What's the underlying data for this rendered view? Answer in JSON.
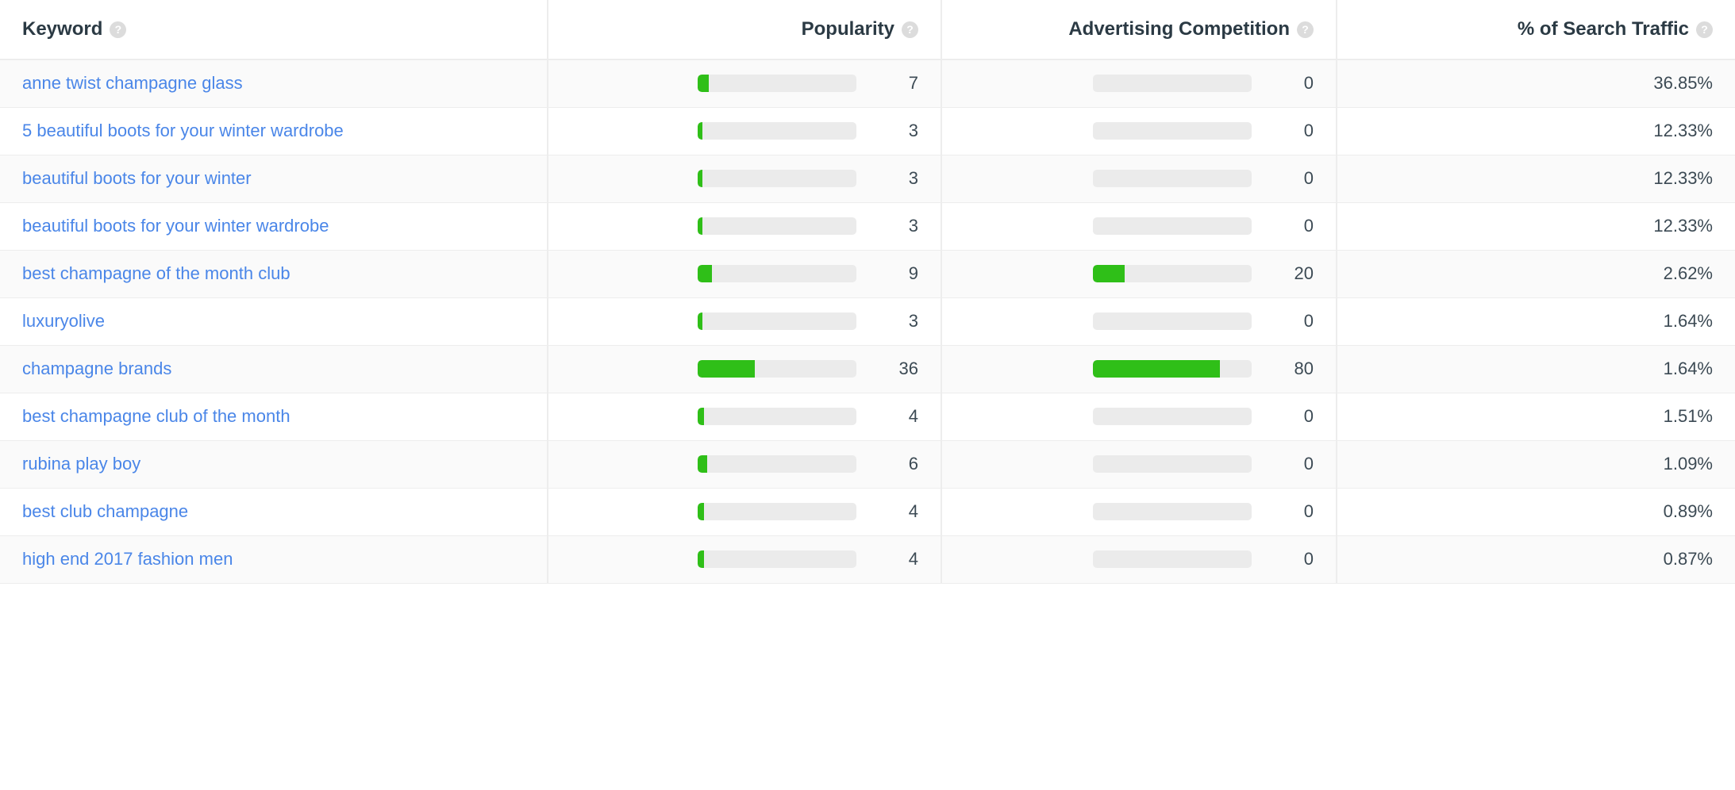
{
  "table": {
    "columns": [
      {
        "key": "keyword",
        "label": "Keyword",
        "help_icon": "help-icon",
        "help_glyph": "?",
        "align": "left"
      },
      {
        "key": "popularity",
        "label": "Popularity",
        "help_icon": "help-icon",
        "help_glyph": "?",
        "align": "right"
      },
      {
        "key": "competition",
        "label": "Advertising Competition",
        "help_icon": "help-icon",
        "help_glyph": "?",
        "align": "right"
      },
      {
        "key": "traffic",
        "label": "% of Search Traffic",
        "help_icon": "help-icon",
        "help_glyph": "?",
        "align": "right"
      }
    ],
    "bar_scale_max": 100,
    "colors": {
      "bar_fill": "#2fbf18",
      "bar_track": "#ebebeb",
      "link": "#4a86e8",
      "text": "#3c4a54",
      "header_text": "#2b3a44",
      "row_odd": "#fafafa",
      "row_even": "#ffffff",
      "border": "#ededed"
    },
    "rows": [
      {
        "keyword": "anne twist champagne glass",
        "popularity": "7",
        "popularity_pct": 7,
        "competition": "0",
        "competition_pct": 0,
        "traffic": "36.85%"
      },
      {
        "keyword": "5 beautiful boots for your winter wardrobe",
        "popularity": "3",
        "popularity_pct": 3,
        "competition": "0",
        "competition_pct": 0,
        "traffic": "12.33%"
      },
      {
        "keyword": "beautiful boots for your winter",
        "popularity": "3",
        "popularity_pct": 3,
        "competition": "0",
        "competition_pct": 0,
        "traffic": "12.33%"
      },
      {
        "keyword": "beautiful boots for your winter wardrobe",
        "popularity": "3",
        "popularity_pct": 3,
        "competition": "0",
        "competition_pct": 0,
        "traffic": "12.33%"
      },
      {
        "keyword": "best champagne of the month club",
        "popularity": "9",
        "popularity_pct": 9,
        "competition": "20",
        "competition_pct": 20,
        "traffic": "2.62%"
      },
      {
        "keyword": "luxuryolive",
        "popularity": "3",
        "popularity_pct": 3,
        "competition": "0",
        "competition_pct": 0,
        "traffic": "1.64%"
      },
      {
        "keyword": "champagne brands",
        "popularity": "36",
        "popularity_pct": 36,
        "competition": "80",
        "competition_pct": 80,
        "traffic": "1.64%"
      },
      {
        "keyword": "best champagne club of the month",
        "popularity": "4",
        "popularity_pct": 4,
        "competition": "0",
        "competition_pct": 0,
        "traffic": "1.51%"
      },
      {
        "keyword": "rubina play boy",
        "popularity": "6",
        "popularity_pct": 6,
        "competition": "0",
        "competition_pct": 0,
        "traffic": "1.09%"
      },
      {
        "keyword": "best club champagne",
        "popularity": "4",
        "popularity_pct": 4,
        "competition": "0",
        "competition_pct": 0,
        "traffic": "0.89%"
      },
      {
        "keyword": "high end 2017 fashion men",
        "popularity": "4",
        "popularity_pct": 4,
        "competition": "0",
        "competition_pct": 0,
        "traffic": "0.87%"
      }
    ]
  }
}
